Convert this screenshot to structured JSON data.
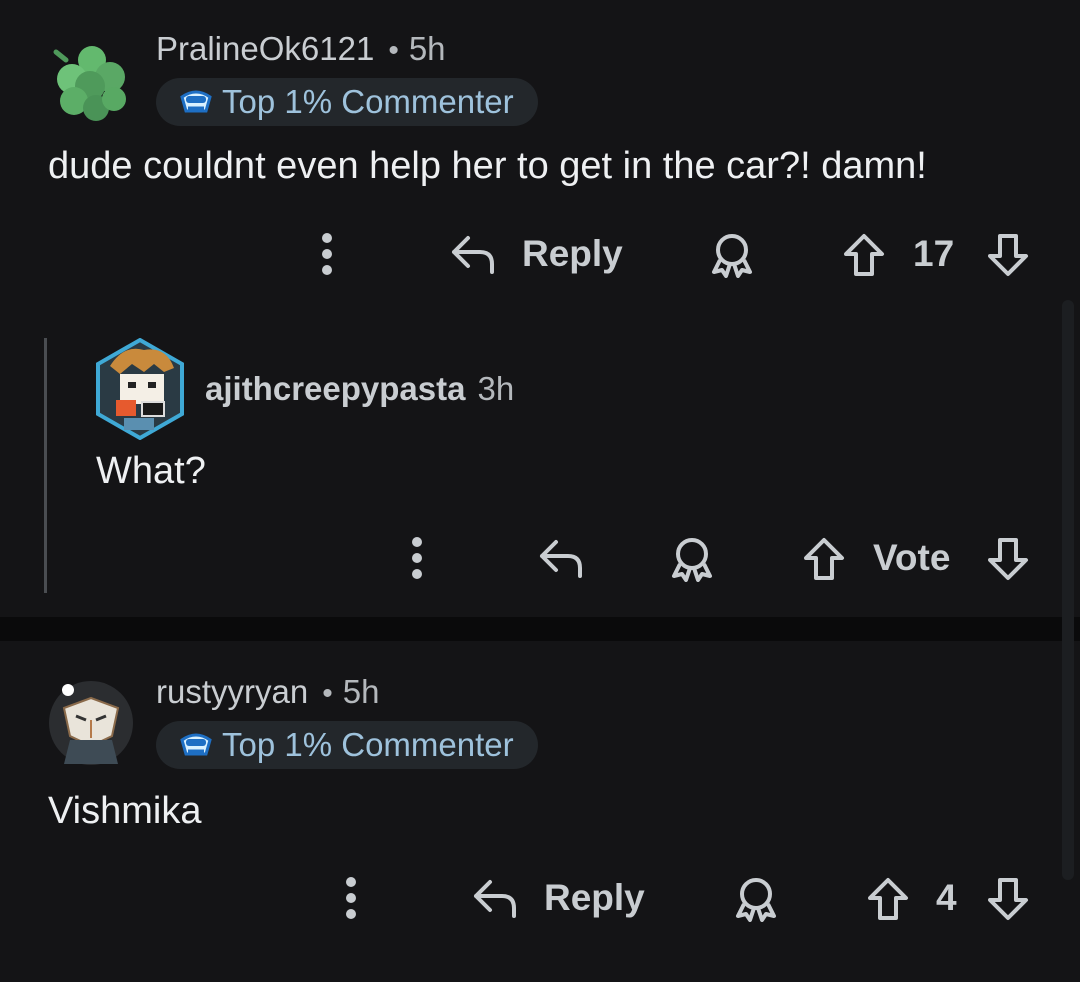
{
  "comments": [
    {
      "username": "PralineOk6121",
      "time": "5h",
      "badge": "Top 1% Commenter",
      "body": "dude couldnt even help her to get in the car?! damn!",
      "reply_label": "Reply",
      "vote_count": "17"
    },
    {
      "username": "ajithcreepypasta",
      "time": "3h",
      "body": "What?",
      "vote_label": "Vote"
    },
    {
      "username": "rustyyryan",
      "time": "5h",
      "badge": "Top 1% Commenter",
      "body": "Vishmika",
      "reply_label": "Reply",
      "vote_count": "4"
    }
  ],
  "separator": "•",
  "icons": {
    "more": "more-vertical-icon",
    "reply": "reply-arrow-icon",
    "award": "award-icon",
    "upvote": "upvote-arrow-icon",
    "downvote": "downvote-arrow-icon",
    "badge": "commenter-badge-icon"
  },
  "colors": {
    "background": "#141416",
    "badge_bg": "#23272b",
    "badge_text": "#9ec2dc",
    "muted": "#c9cdd1"
  }
}
